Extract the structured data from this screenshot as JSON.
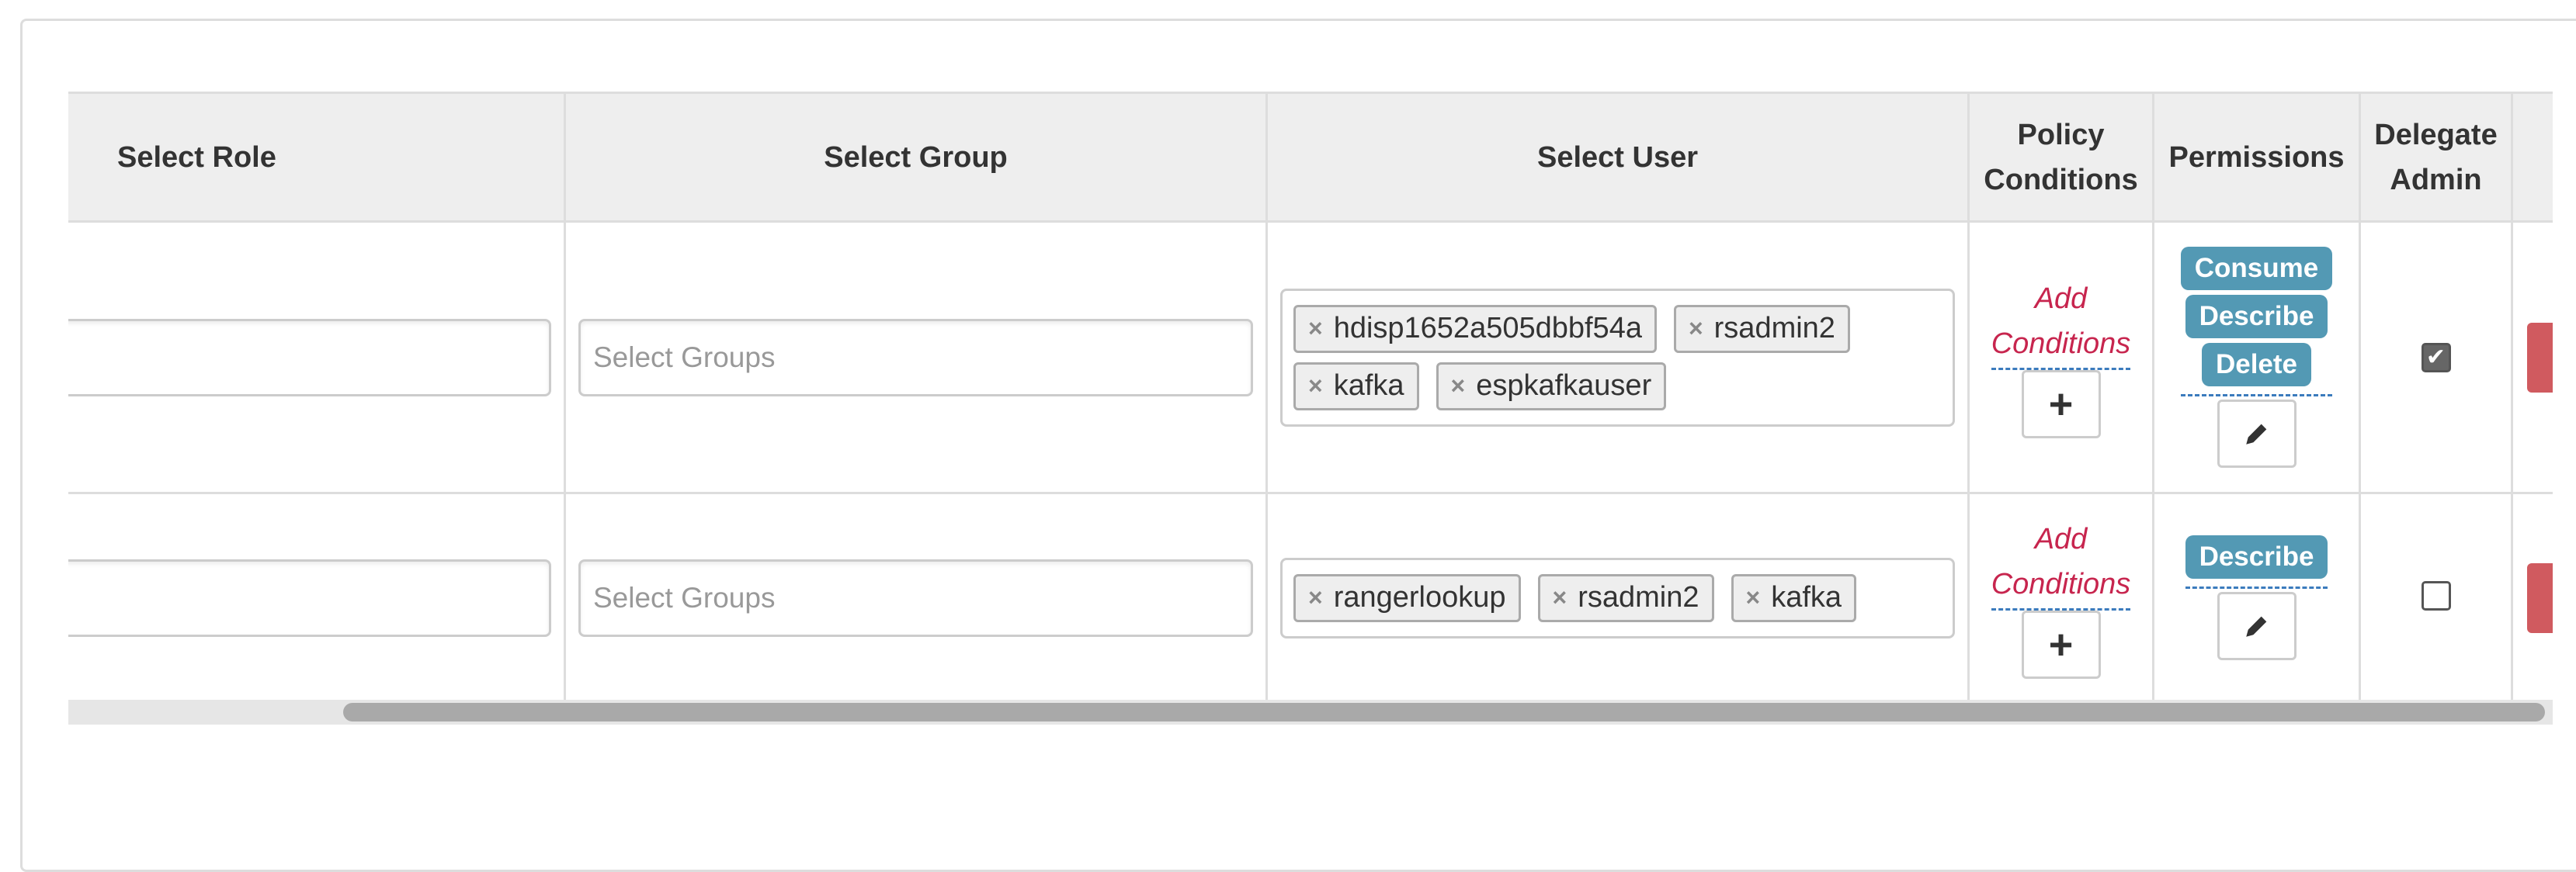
{
  "table": {
    "headers": {
      "role": "Select Role",
      "group": "Select Group",
      "user": "Select User",
      "conditions_line1": "Policy",
      "conditions_line2": "Conditions",
      "permissions": "Permissions",
      "delegate_line1": "Delegate",
      "delegate_line2": "Admin"
    },
    "rows": [
      {
        "group_placeholder": "Select Groups",
        "users": [
          "hdisp1652a505dbbf54a",
          "rsadmin2",
          "kafka",
          "espkafkauser"
        ],
        "conditions_line1": "Add",
        "conditions_line2": "Conditions",
        "permissions": [
          "Consume",
          "Describe",
          "Delete"
        ],
        "delegate_admin": true
      },
      {
        "group_placeholder": "Select Groups",
        "users": [
          "rangerlookup",
          "rsadmin2",
          "kafka"
        ],
        "conditions_line1": "Add",
        "conditions_line2": "Conditions",
        "permissions": [
          "Describe"
        ],
        "delegate_admin": false
      }
    ]
  },
  "icons": {
    "tag_remove": "×",
    "add": "+",
    "edit": "pencil-icon",
    "delete": "✖",
    "check": "✔"
  },
  "colors": {
    "permission_badge": "#5399b4",
    "delete_button": "#d05a5f",
    "add_conditions_link": "#c7254e"
  }
}
